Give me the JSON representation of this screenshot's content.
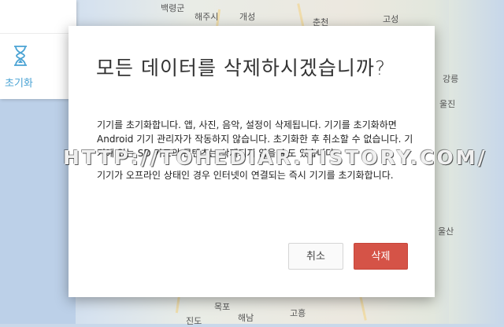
{
  "map": {
    "labels": [
      "백령군",
      "해주시",
      "개성",
      "춘천",
      "강릉",
      "고성",
      "울진",
      "울산",
      "목포",
      "고흥",
      "해남",
      "진도"
    ]
  },
  "sidebar": {
    "hourglass_icon": "hourglass-icon",
    "caption": "초기화",
    "accent": "#4aa3d4"
  },
  "dialog": {
    "title": "모든 데이터를 삭제하시겠습니까?",
    "body_1": "기기를 초기화합니다. 앱, 사진, 음악, 설정이 삭제됩니다. 기기를 초기화하면 Android 기기 관리자가 작동하지 않습니다. 초기화한 후 취소할 수 없습니다. 기기에 있는 SD 카드의 콘텐츠는 삭제되지 않을 수도 있습니다.",
    "body_2": "기기가 오프라인 상태인 경우 인터넷이 연결되는 즉시 기기를 초기화합니다.",
    "cancel_label": "취소",
    "delete_label": "삭제",
    "delete_color": "#d55347"
  },
  "watermark": {
    "text": "HTTP://TOHEDIAR.TISTORY.COM/"
  }
}
